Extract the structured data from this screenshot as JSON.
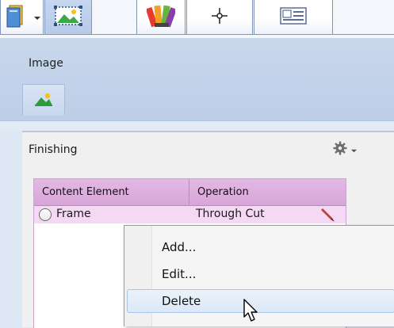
{
  "tabs": [
    {
      "icon": "document-book-icon",
      "has_dropdown": true,
      "active": false
    },
    {
      "icon": "image-frame-icon",
      "has_dropdown": false,
      "active": true
    },
    {
      "icon": "color-swatch-icon",
      "has_dropdown": false,
      "active": false
    },
    {
      "icon": "crosshair-icon",
      "has_dropdown": false,
      "active": false
    },
    {
      "icon": "id-card-icon",
      "has_dropdown": false,
      "active": false
    }
  ],
  "ribbon": {
    "label": "Image",
    "button_icon": "image-icon"
  },
  "panel": {
    "title": "Finishing",
    "settings_icon": "gear-icon"
  },
  "grid": {
    "columns": [
      "Content Element",
      "Operation"
    ],
    "rows": [
      {
        "element": "Frame",
        "operation": "Through Cut"
      }
    ]
  },
  "context_menu": {
    "items": [
      {
        "label": "Add...",
        "highlighted": false
      },
      {
        "label": "Edit...",
        "highlighted": false
      },
      {
        "label": "Delete",
        "highlighted": true
      }
    ]
  },
  "colors": {
    "header_accent": "#d9a9da",
    "row_selected": "#f5d9f4",
    "ribbon": "#c4d3ea",
    "menu_highlight": "#dbe8f7"
  }
}
